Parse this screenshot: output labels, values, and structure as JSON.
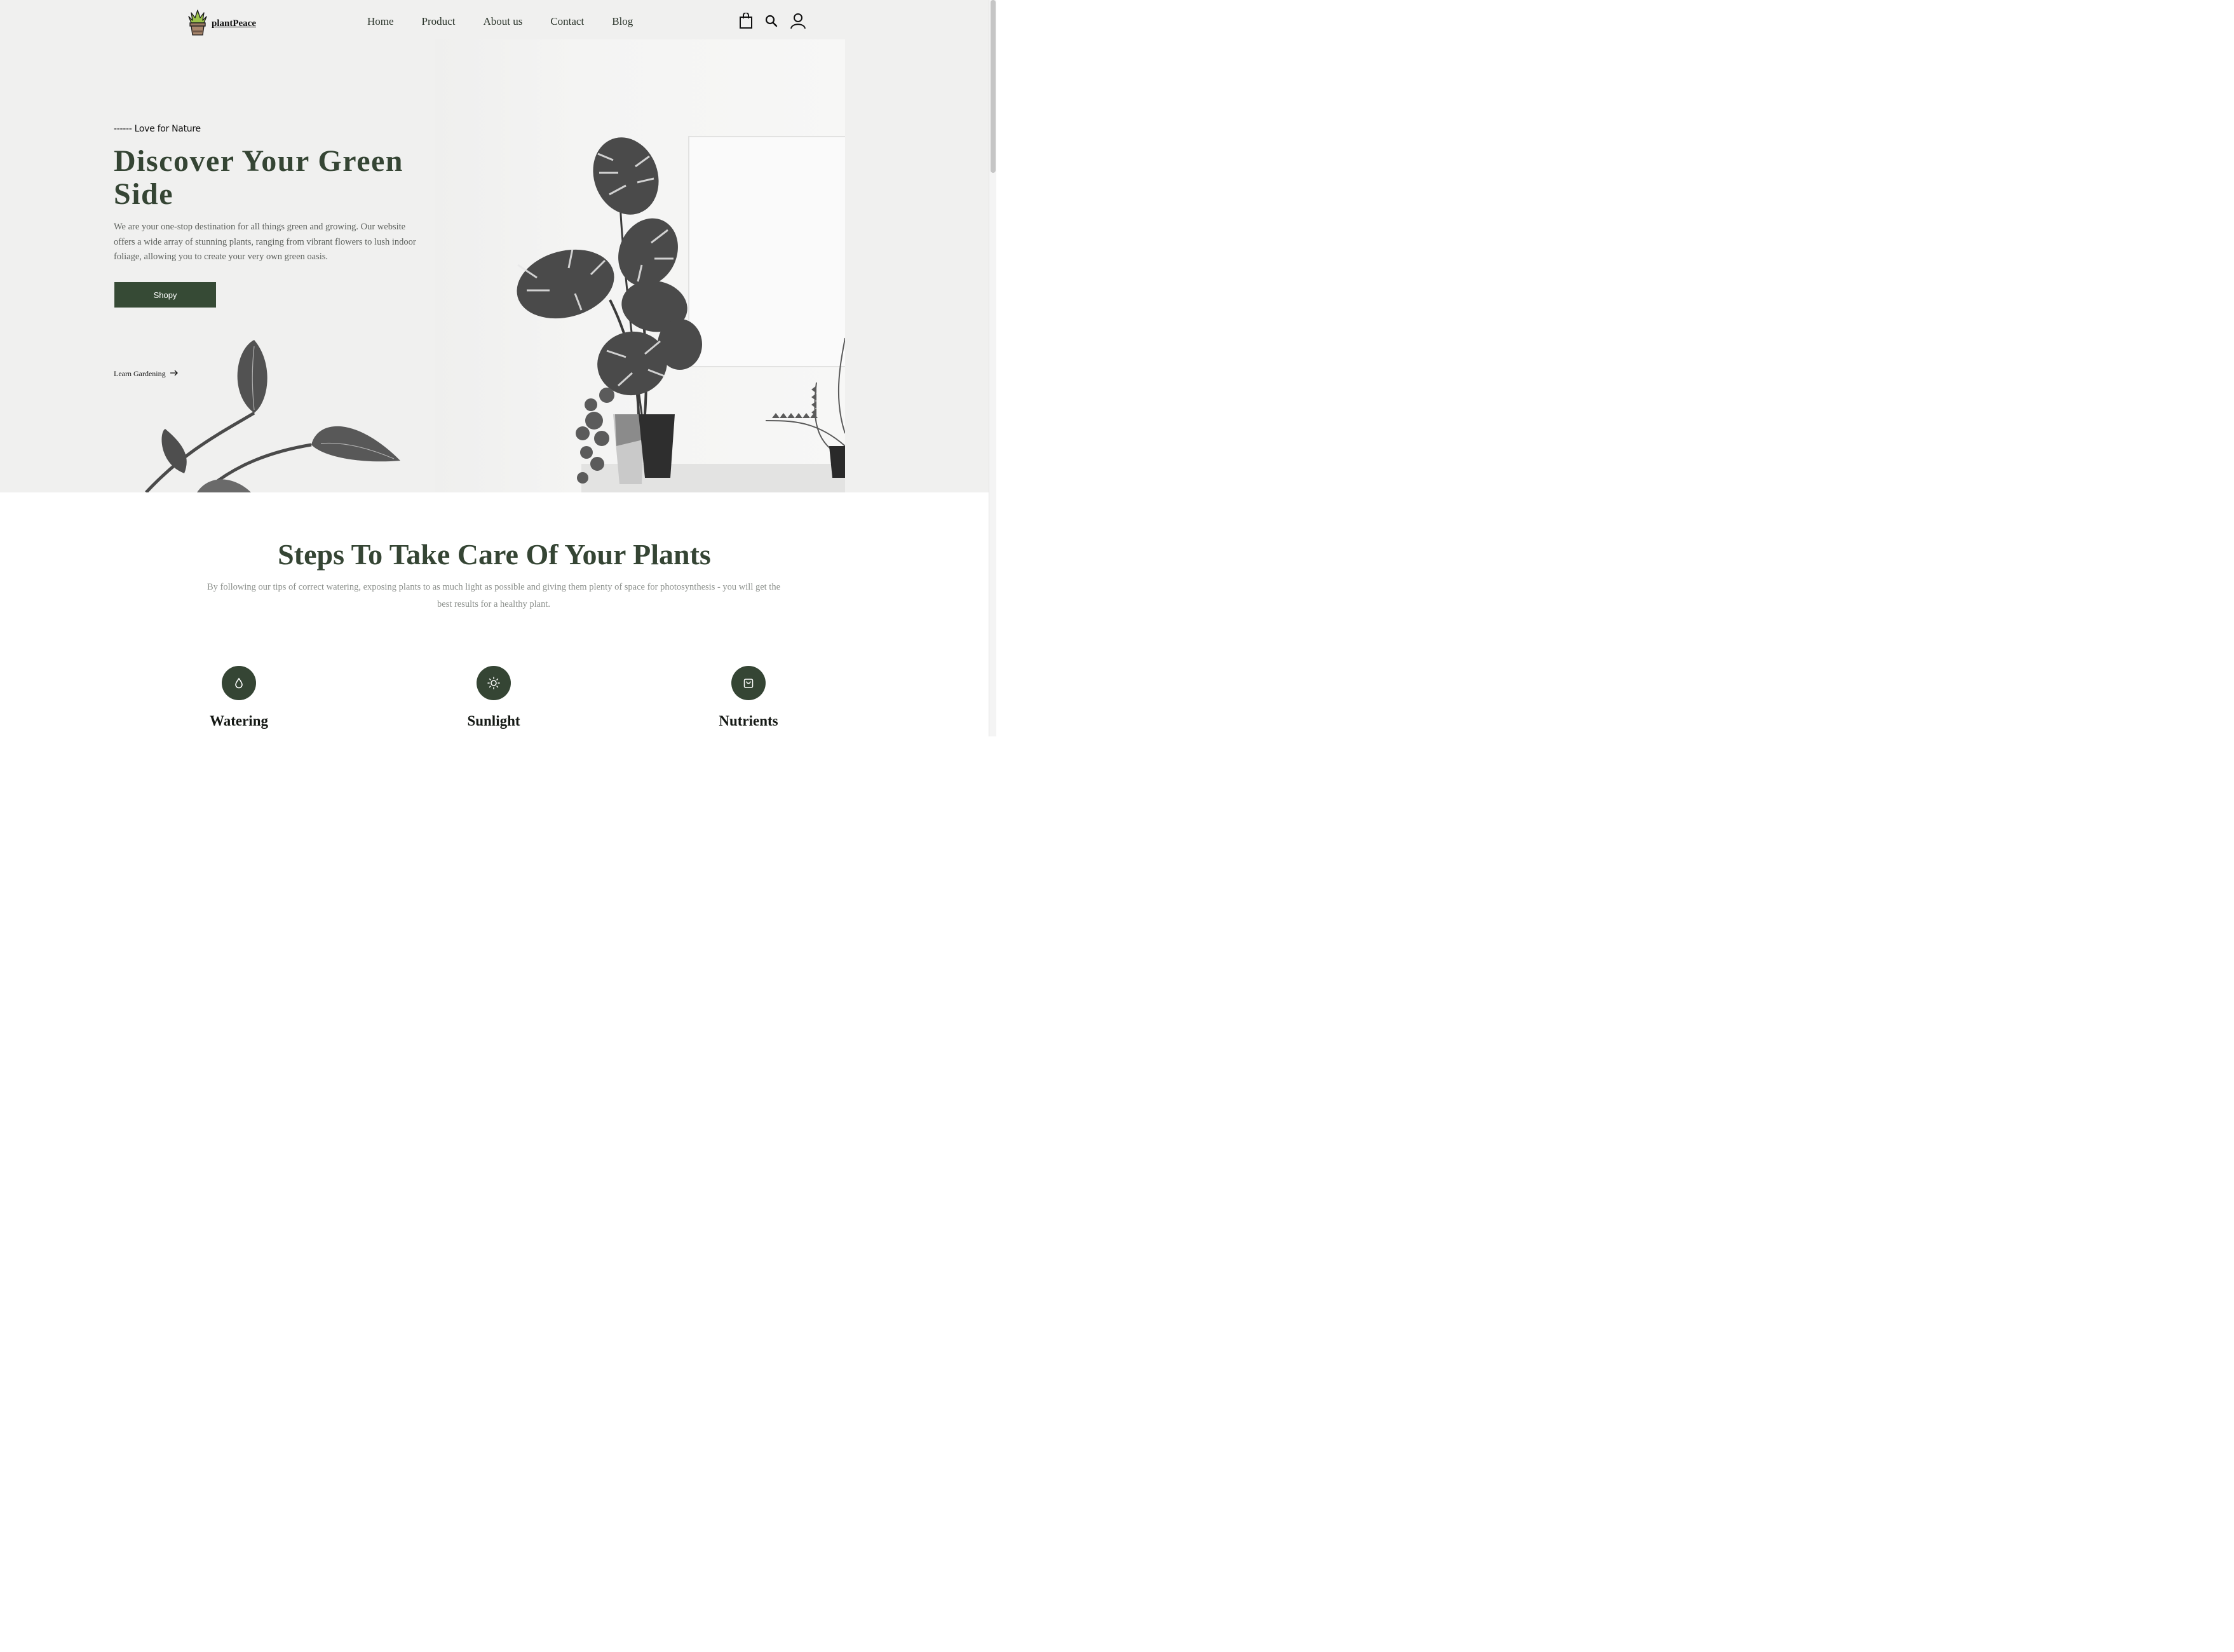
{
  "nav": {
    "brand": "plantPeace",
    "logo_icon": "potted-plant-icon",
    "links": [
      "Home",
      "Product",
      "About us",
      "Contact",
      "Blog"
    ],
    "icons": [
      "shopping-bag-icon",
      "search-icon",
      "user-icon"
    ]
  },
  "hero": {
    "tagline": "------ Love for Nature",
    "title": "Discover Your Green Side",
    "description": "We are your one-stop destination for all things green and growing. Our website offers a wide array of stunning plants, ranging from vibrant flowers to lush indoor foliage, allowing you to create your very own green oasis.",
    "button_label": "Shopy",
    "learn_link": "Learn Gardening",
    "learn_icon": "arrow-right-icon"
  },
  "steps": {
    "title": "Steps To Take Care Of Your Plants",
    "description": "By following our tips of correct watering, exposing plants to as much light as possible and giving them plenty of space for photosynthesis - you will get the best results for a healthy plant.",
    "items": [
      {
        "label": "Watering",
        "icon": "water-drop-icon"
      },
      {
        "label": "Sunlight",
        "icon": "sun-icon"
      },
      {
        "label": "Nutrients",
        "icon": "shopping-bag-icon"
      }
    ]
  },
  "colors": {
    "brand_green": "#354534",
    "hero_bg": "#f0f0ef",
    "muted_text": "#8d918d"
  }
}
